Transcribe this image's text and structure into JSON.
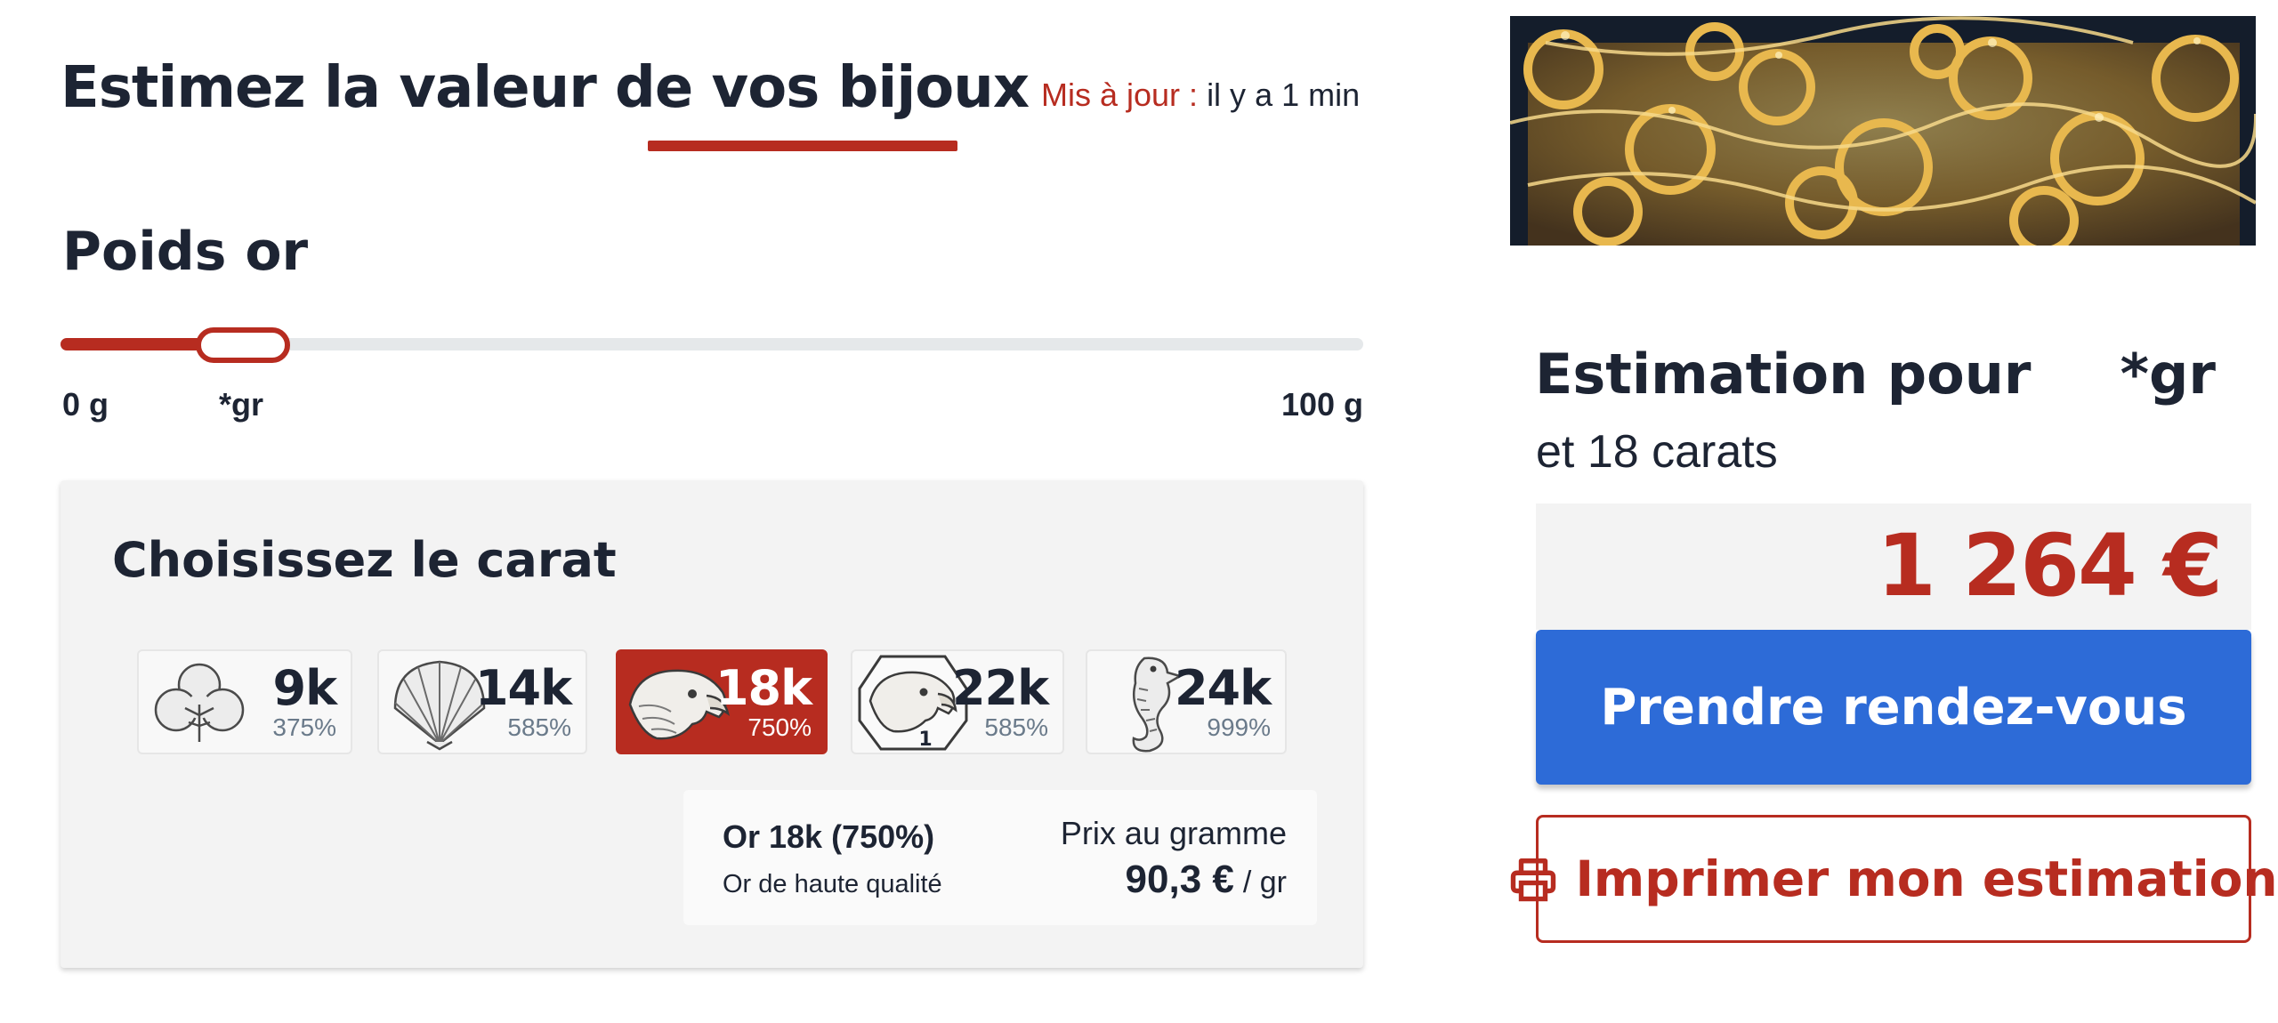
{
  "header": {
    "title": "Estimez la valeur de vos bijoux",
    "updated_label": "Mis à jour :",
    "updated_value": "il y a 1 min"
  },
  "weight": {
    "section_title": "Poids or",
    "min_label": "0 g",
    "max_label": "100 g",
    "value_label": "*gr",
    "value_fraction": 0.14
  },
  "carat": {
    "title": "Choisissez le carat",
    "options": [
      {
        "karat": "9k",
        "purity": "375%",
        "icon": "clover-hallmark-icon",
        "selected": false
      },
      {
        "karat": "14k",
        "purity": "585%",
        "icon": "shell-hallmark-icon",
        "selected": false
      },
      {
        "karat": "18k",
        "purity": "750%",
        "icon": "eagle-hallmark-icon",
        "selected": true
      },
      {
        "karat": "22k",
        "purity": "585%",
        "icon": "eagle-1-hallmark-icon",
        "selected": false
      },
      {
        "karat": "24k",
        "purity": "999%",
        "icon": "seahorse-hallmark-icon",
        "selected": false
      }
    ],
    "info": {
      "name": "Or 18k (750%)",
      "description": "Or de haute qualité",
      "price_label": "Prix au gramme",
      "price_value": "90,3 €",
      "price_unit": "/ gr"
    }
  },
  "estimate": {
    "image_icon": "gold-jewelry-photo",
    "title": "Estimation pour",
    "weight": "*gr",
    "subtitle": "et 18 carats",
    "price": "1 264 €",
    "book_button": "Prendre rendez-vous",
    "print_button": "Imprimer mon estimation",
    "print_icon": "printer-icon"
  },
  "colors": {
    "accent_red": "#b72c20",
    "primary_blue": "#2d6bd7",
    "text_dark": "#1d2433",
    "panel_grey": "#f3f3f3"
  }
}
